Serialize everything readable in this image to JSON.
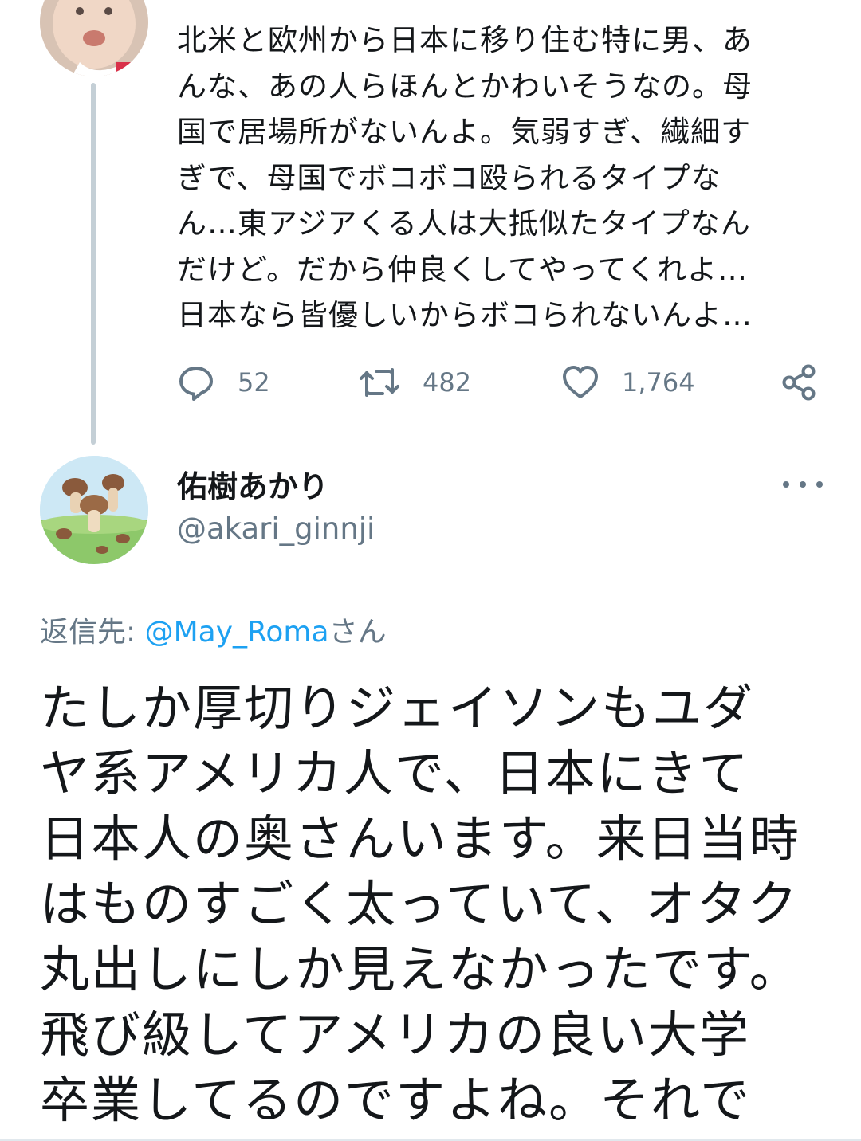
{
  "tweet_above": {
    "avatar_icon": "baby-photo-avatar",
    "text": "北米と欧州から日本に移り住む特に男、あ\nんな、あの人らほんとかわいそうなの。母\n国で居場所がないんよ。気弱すぎ、繊細す\nぎで、母国でボコボコ殴られるタイプな\nん…東アジアくる人は大抵似たタイプなん\nだけど。だから仲良くしてやってくれよ…\n日本なら皆優しいからボコられないんよ…",
    "actions": {
      "reply_count": "52",
      "retweet_count": "482",
      "like_count": "1,764"
    }
  },
  "reply_tweet": {
    "avatar_icon": "mushroom-illustration-avatar",
    "display_name": "佑樹あかり",
    "handle": "@akari_ginnji",
    "reply_to_label": "返信先: ",
    "reply_to_mention": "@May_Roma",
    "reply_to_suffix": "さん",
    "text": "たしか厚切りジェイソンもユダ\nヤ系アメリカ人で、日本にきて\n日本人の奥さんいます。来日当時\nはものすごく太っていて、オタク\n丸出しにしか見えなかったです。\n飛び級してアメリカの良い大学\n卒業してるのですよね。それで"
  },
  "colors": {
    "text_primary": "#14171a",
    "text_secondary": "#657786",
    "link": "#1da1f2",
    "thread_line": "#c4cfd6"
  }
}
